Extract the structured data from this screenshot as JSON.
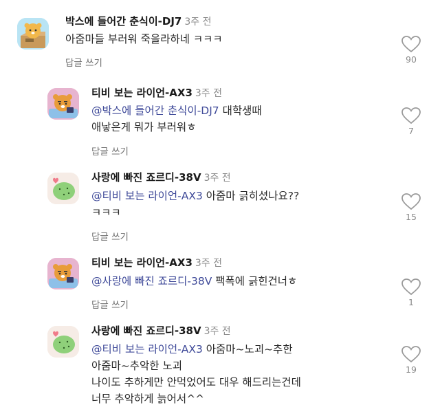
{
  "comments": [
    {
      "author": "박스에 들어간 춘식이-DJ7",
      "time": "3주 전",
      "mention": "",
      "lines": [
        "아줌마들 부러워 죽을라하네 ㅋㅋㅋ"
      ],
      "reply_label": "답글 쓰기",
      "likes": "90",
      "avatar_icon": "chunsik-box-avatar-icon"
    },
    {
      "author": "티비 보는 라이언-AX3",
      "time": "3주 전",
      "mention": "@박스에 들어간 춘식이-DJ7",
      "lines": [
        " 대학생때",
        "애낳은게 뭐가 부러워ㅎ"
      ],
      "reply_label": "답글 쓰기",
      "likes": "7",
      "avatar_icon": "ryan-tv-avatar-icon"
    },
    {
      "author": "사랑에 빠진 죠르디-38V",
      "time": "3주 전",
      "mention": "@티비 보는 라이언-AX3",
      "lines": [
        " 아줌마 긁히셨나요??",
        "ㅋㅋㅋ"
      ],
      "reply_label": "답글 쓰기",
      "likes": "15",
      "avatar_icon": "jordy-love-avatar-icon"
    },
    {
      "author": "티비 보는 라이언-AX3",
      "time": "3주 전",
      "mention": "@사랑에 빠진 죠르디-38V",
      "lines": [
        " 팩폭에 긁힌건너ㅎ"
      ],
      "reply_label": "답글 쓰기",
      "likes": "1",
      "avatar_icon": "ryan-tv-avatar-icon"
    },
    {
      "author": "사랑에 빠진 죠르디-38V",
      "time": "3주 전",
      "mention": "@티비 보는 라이언-AX3",
      "lines": [
        " 아줌마~노괴~추한",
        "아줌마~추악한 노괴",
        "나이도 추하게만 안먹었어도 대우 해드리는건데",
        "너무 추악하게 늙어서^^"
      ],
      "reply_label": "",
      "likes": "19",
      "avatar_icon": "jordy-love-avatar-icon"
    }
  ],
  "colors": {
    "mention": "#3f4a99",
    "muted": "#8a8a8a",
    "author": "#1a1a1a"
  }
}
